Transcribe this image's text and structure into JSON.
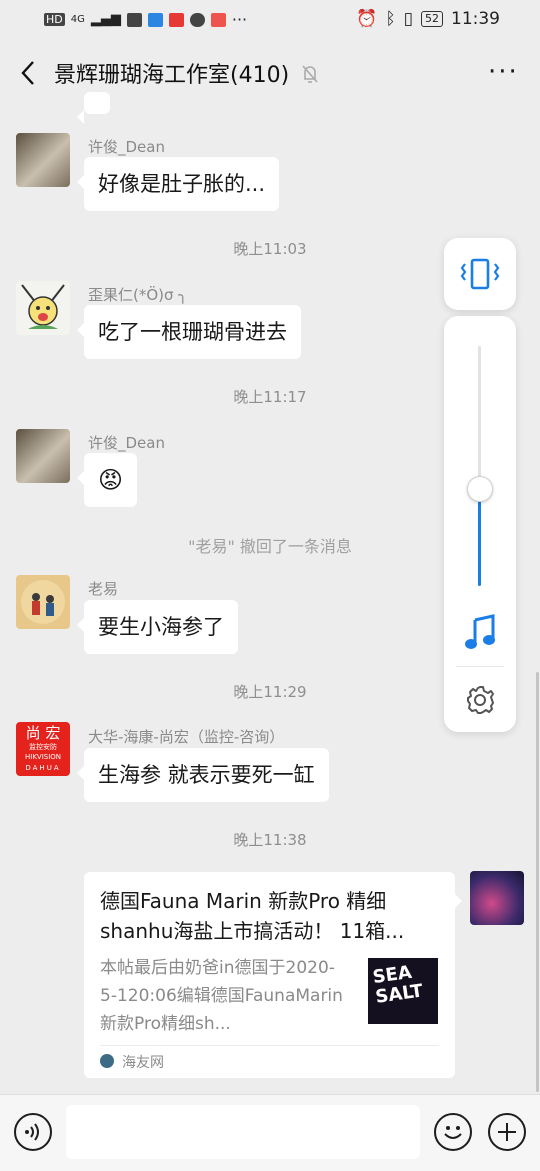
{
  "statusbar": {
    "left_label": "HD",
    "network": "4G",
    "battery": "52",
    "time": "11:39"
  },
  "titlebar": {
    "title": "景辉珊瑚海工作室(410)",
    "more": "···"
  },
  "messages": [
    {
      "nick": "许俊_Dean",
      "text": "好像是肚子胀的..."
    },
    {
      "time": "晚上11:03"
    },
    {
      "nick": "歪果仁(*Ö)σ   ╮",
      "text": "吃了一根珊瑚骨进去"
    },
    {
      "time": "晚上11:17"
    },
    {
      "nick": "许俊_Dean",
      "text": "😡"
    },
    {
      "system": "\"老易\" 撤回了一条消息"
    },
    {
      "nick": "老易",
      "text": "要生小海参了"
    },
    {
      "time": "晚上11:29"
    },
    {
      "nick": "大华-海康-尚宏（监控-咨询）",
      "text": "生海参 就表示要死一缸"
    },
    {
      "time": "晚上11:38"
    }
  ],
  "avatars": {
    "hikvision_line1": "尚 宏",
    "hikvision_line2": "监控安防",
    "hikvision_line3": "HIKVISION",
    "hikvision_line4": "DAHUA"
  },
  "share_card": {
    "title": "德国Fauna Marin 新款Pro 精细shanhu海盐上市搞活动！ 11箱...",
    "desc": "本帖最后由奶爸in德国于2020-5-120:06编辑德国FaunaMarin新款Pro精细sh...",
    "source": "海友网",
    "thumb_text": "SEA SALT"
  },
  "volume": {
    "level": 0.41
  },
  "colors": {
    "accent": "#1a7ee6",
    "background": "#ededed"
  }
}
